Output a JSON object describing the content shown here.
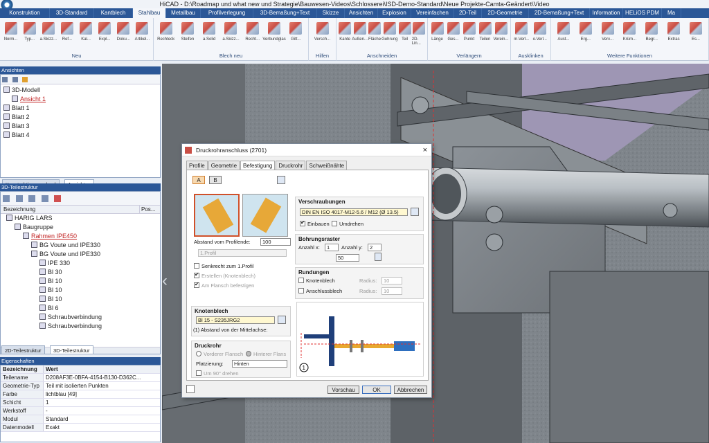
{
  "window": {
    "title": "HiCAD - D:\\Roadmap und what new und Strategie\\Bauwesen-Videos\\Schlosserei\\ISD-Demo-Standard\\Neue Projekte-Camta-Geändert\\Video"
  },
  "ribbon": {
    "tabs": [
      "Konstruktion",
      "3D-Standard",
      "Kantblech",
      "Stahlbau",
      "Metallbau",
      "Profilverlegung",
      "3D-Bemaßung+Text",
      "Skizze",
      "Ansichten",
      "Explosion",
      "Vereinfachen",
      "2D-Teil",
      "2D-Geometrie",
      "2D-Bemaßung+Text",
      "Information",
      "HELiOS PDM",
      "Ma"
    ],
    "active_tab": "Stahlbau",
    "groups": [
      {
        "label": "Neu",
        "items": [
          "Norm...",
          "Typ...",
          "a.Skizz...",
          "Ref...",
          "Kal...",
          "Expl...",
          "Doku...",
          "Artikel..."
        ]
      },
      {
        "label": "Blech neu",
        "items": [
          "Rechteck",
          "Steifen",
          "a.Solid",
          "a.Skizz...",
          "Recht...",
          "Verbundglas",
          "Gitt..."
        ]
      },
      {
        "label": "Hilfen",
        "items": [
          "Versch..."
        ]
      },
      {
        "label": "Anschneiden",
        "items": [
          "Kante",
          "Außen...",
          "Fläche",
          "Gehrung",
          "Teil",
          "2D-Lin..."
        ]
      },
      {
        "label": "Verlängern",
        "items": [
          "Länge",
          "Ges...",
          "Punkt",
          "Teilen",
          "Verein..."
        ]
      },
      {
        "label": "Ausklinken",
        "items": [
          "m.Verl...",
          "o.Verl..."
        ]
      },
      {
        "label": "Weitere Funktionen",
        "items": [
          "Aust...",
          "Erg...",
          "Verx...",
          "Krüm...",
          "Begr...",
          "Extras",
          "Es..."
        ]
      }
    ]
  },
  "views_panel": {
    "header": "Ansichten",
    "tree": [
      {
        "label": "3D-Modell",
        "indent": 0
      },
      {
        "label": "Ansicht 1",
        "indent": 1,
        "selected": true
      },
      {
        "label": "Blatt 1",
        "indent": 0
      },
      {
        "label": "Blatt 2",
        "indent": 0
      },
      {
        "label": "Blatt 3",
        "indent": 0
      },
      {
        "label": "Blatt 4",
        "indent": 0
      }
    ],
    "bottom_tabs": [
      "Konstruktionswechsel",
      "Ansichten"
    ]
  },
  "parts_panel": {
    "header": "3D-Teilestruktur",
    "col_name": "Bezeichnung",
    "col_pos": "Pos...",
    "tree": [
      {
        "label": "HARIG LARS",
        "indent": 0
      },
      {
        "label": "Baugruppe",
        "indent": 1
      },
      {
        "label": "Rahmen IPE450",
        "indent": 2,
        "selected": true
      },
      {
        "label": "BG Voute und IPE330",
        "indent": 3
      },
      {
        "label": "BG Voute und IPE330",
        "indent": 3
      },
      {
        "label": "IPE 330",
        "indent": 4
      },
      {
        "label": "Bl 30",
        "indent": 4
      },
      {
        "label": "Bl 10",
        "indent": 4
      },
      {
        "label": "Bl 10",
        "indent": 4
      },
      {
        "label": "Bl 10",
        "indent": 4
      },
      {
        "label": "Bl 6",
        "indent": 4
      },
      {
        "label": "Schraubverbindung",
        "indent": 4
      },
      {
        "label": "Schraubverbindung",
        "indent": 4
      }
    ],
    "bottom_tabs": [
      "2D-Teilestruktur",
      "3D-Teilestruktur"
    ]
  },
  "properties": {
    "header": "Eigenschaften",
    "col_key": "Bezeichnung",
    "col_val": "Wert",
    "rows": [
      [
        "Teilename",
        "D208AF3E-0BFA-4154-B130-D362C..."
      ],
      [
        "Geometrie-Typ",
        "Teil mit isolierten Punkten"
      ],
      [
        "Farbe",
        "lichtblau [49]"
      ],
      [
        "Schicht",
        "1"
      ],
      [
        "Werkstoff",
        "-"
      ],
      [
        "Modul",
        "Standard"
      ],
      [
        "Datenmodell",
        "Exakt"
      ]
    ]
  },
  "dialog": {
    "title": "Druckrohranschluss (2701)",
    "tabs": [
      "Profile",
      "Geometrie",
      "Befestigung",
      "Druckrohr",
      "Schweißnähte"
    ],
    "active_tab": "Befestigung",
    "variant_buttons": [
      "A",
      "B"
    ],
    "abstand_label": "Abstand vom Profilende:",
    "abstand_value": "100",
    "profil_placeholder": "1.Profil",
    "checks_left": [
      {
        "label": "Senkrecht zum 1.Profil",
        "checked": false,
        "disabled": false
      },
      {
        "label": "Erstellen (Knotenblech)",
        "checked": true,
        "disabled": true
      },
      {
        "label": "Am Flansch befestigen",
        "checked": true,
        "disabled": true
      }
    ],
    "knotenblech_title": "Knotenblech",
    "knotenblech_value": "Bl 15 - S235JRG2",
    "knotenblech_option": "(1) Abstand von der Mittelachse:",
    "druckrohr_title": "Druckrohr",
    "radio_front": "Vorderer Flansch",
    "radio_back": "Hinterer Flans",
    "platzierung_label": "Platzierung:",
    "platzierung_value": "Hinten",
    "um90_label": "Um 90° drehen",
    "verschraubungen_title": "Verschraubungen",
    "verschraubung_value": "DIN EN ISO 4017-M12-5.6 / M12 (Ø 13.5)",
    "einbauen": "Einbauen",
    "umdrehen": "Umdrehen",
    "bohrung_title": "Bohrungsraster",
    "anzahl_x_label": "Anzahl x:",
    "anzahl_x": "1",
    "anzahl_y_label": "Anzahl y:",
    "anzahl_y": "2",
    "raster_abstand": "50",
    "rundungen_title": "Rundungen",
    "knotenblech_cb": "Knotenblech",
    "anschlussblech_cb": "Anschlussblech",
    "radius_label": "Radius:",
    "radius_value": "10",
    "preview_marker": "1",
    "btn_preview": "Vorschau",
    "btn_ok": "OK",
    "btn_cancel": "Abbrechen"
  },
  "colors": {
    "ribbon_blue": "#2b5797",
    "accent_red": "#c02020",
    "dialog_bg": "#f0f0f0",
    "input_yellow": "#fff8d0"
  }
}
